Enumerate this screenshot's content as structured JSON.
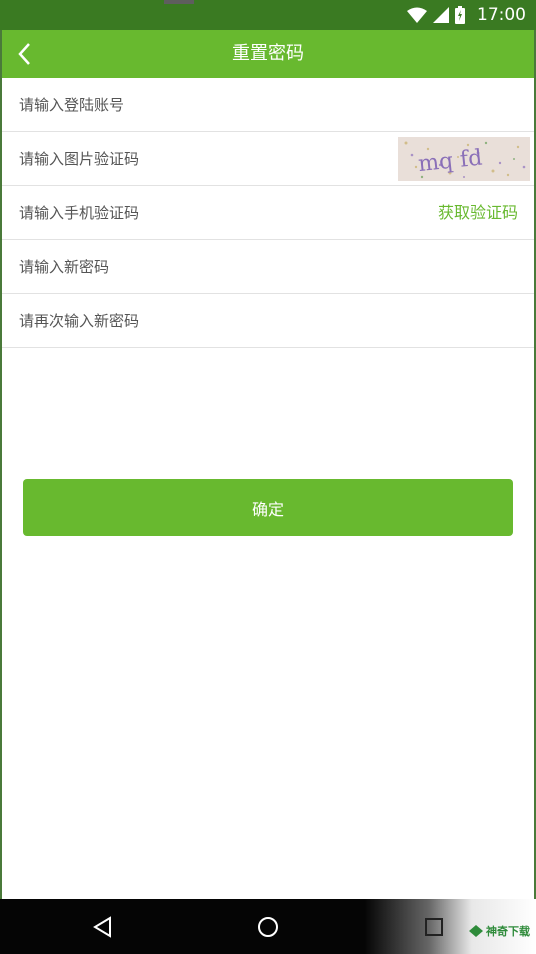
{
  "status_bar": {
    "time": "17:00"
  },
  "app_bar": {
    "title": "重置密码"
  },
  "form": {
    "account_placeholder": "请输入登陆账号",
    "image_code_placeholder": "请输入图片验证码",
    "captcha_text": "mq fd",
    "phone_code_placeholder": "请输入手机验证码",
    "get_code_label": "获取验证码",
    "new_password_placeholder": "请输入新密码",
    "confirm_password_placeholder": "请再次输入新密码"
  },
  "confirm_button": {
    "label": "确定"
  },
  "watermark": {
    "text": "神奇下载"
  },
  "colors": {
    "primary": "#68b92f",
    "status_bar": "#3a7a22"
  }
}
